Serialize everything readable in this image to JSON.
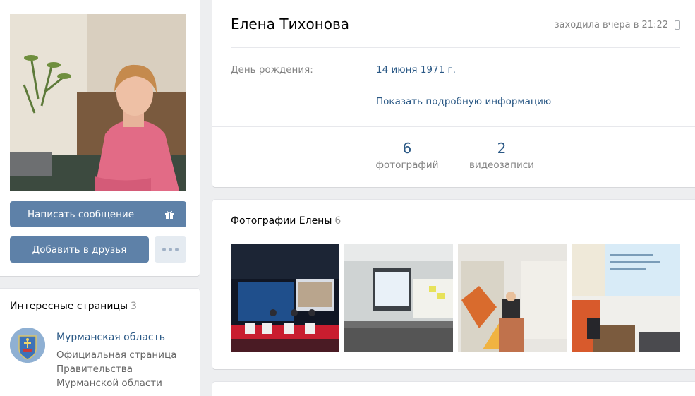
{
  "profile": {
    "name": "Елена Тихонова",
    "last_seen": "заходила вчера в 21:22",
    "birthday_label": "День рождения:",
    "birthday_value": "14 июня 1971 г.",
    "show_more": "Показать подробную информацию"
  },
  "counters": [
    {
      "value": "6",
      "label": "фотографий"
    },
    {
      "value": "2",
      "label": "видеозаписи"
    }
  ],
  "actions": {
    "write_message": "Написать сообщение",
    "add_friend": "Добавить в друзья",
    "gift_icon": "gift-icon",
    "more_icon": "more-dots-icon"
  },
  "photos_block": {
    "title": "Фотографии Елены",
    "count": "6"
  },
  "interesting": {
    "title": "Интересные страницы",
    "count": "3",
    "items": [
      {
        "name": "Мурманская область",
        "desc": "Официальная страница Правительства Мурманской области"
      }
    ]
  },
  "colors": {
    "background": "#edeef0",
    "link": "#2a5885",
    "button": "#5e81a8",
    "button_light": "#e5ebf1",
    "muted": "#828282"
  }
}
